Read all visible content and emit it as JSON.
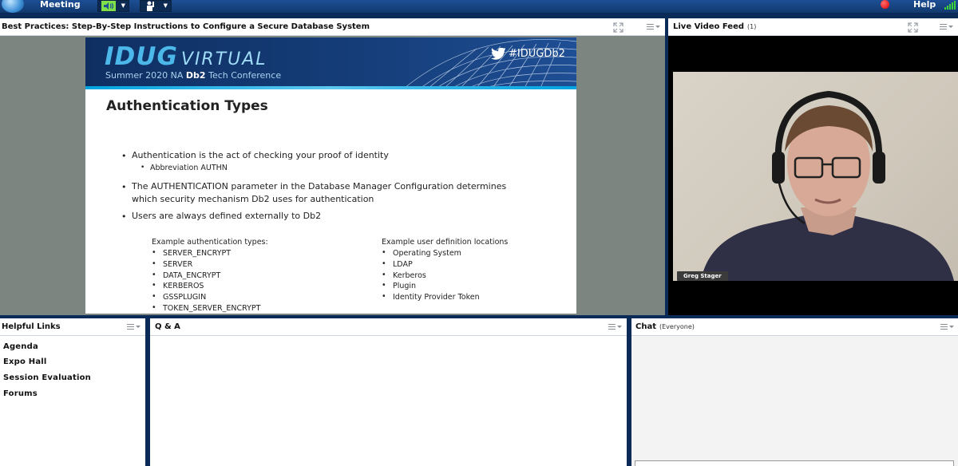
{
  "topbar": {
    "menu_meeting": "Meeting",
    "help": "Help",
    "colors": {
      "bar": "#1d4f95",
      "audio_active": "#7fe04a",
      "record": "#d80000",
      "signal": "#3ad33a"
    }
  },
  "presentation": {
    "title": "Best Practices: Step-By-Step Instructions to Configure a Secure Database System",
    "slide": {
      "brand": "IDUG",
      "brand_suffix": "VIRTUAL",
      "subtitle_pre": "Summer 2020 NA ",
      "subtitle_bold": "Db2",
      "subtitle_post": " Tech Conference",
      "hashtag": "#IDUGDb2",
      "heading": "Authentication Types",
      "bullet_glyph": "•",
      "bullets": [
        {
          "text": "Authentication is the act of checking your proof of identity"
        },
        {
          "text": "Abbreviation AUTHN"
        },
        {
          "text": "The AUTHENTICATION parameter in the Database Manager Configuration determines"
        },
        {
          "text": "which security mechanism Db2 uses for authentication"
        },
        {
          "text": "Users are always defined externally to Db2"
        }
      ],
      "left_list": {
        "heading": "Example authentication types:",
        "items": [
          "SERVER_ENCRYPT",
          "SERVER",
          "DATA_ENCRYPT",
          "KERBEROS",
          "GSSPLUGIN",
          "TOKEN_SERVER_ENCRYPT"
        ]
      },
      "right_list": {
        "heading": "Example user definition locations",
        "items": [
          "Operating System",
          "LDAP",
          "Kerberos",
          "Plugin",
          "Identity Provider Token"
        ]
      }
    }
  },
  "video": {
    "title": "Live Video Feed",
    "count": "(1)",
    "presenter_name": "Greg Stager"
  },
  "links": {
    "title": "Helpful Links",
    "items": [
      "Agenda",
      "Expo Hall",
      "Session Evaluation",
      "Forums"
    ]
  },
  "qa": {
    "title": "Q & A"
  },
  "chat": {
    "title": "Chat",
    "audience": "(Everyone)"
  }
}
